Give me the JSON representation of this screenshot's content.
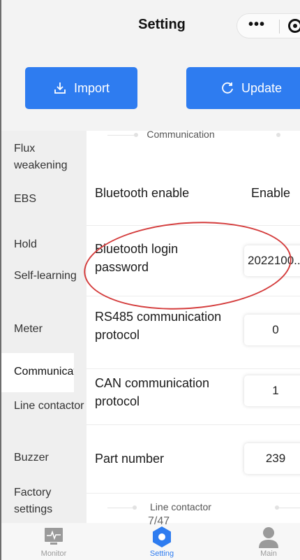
{
  "title_bar": {
    "title": "Setting",
    "more_icon": "more-dots-icon",
    "capsule_icon": "target-icon"
  },
  "actions": {
    "import_label": "Import",
    "update_label": "Update",
    "import_icon": "download-tray-icon",
    "update_icon": "refresh-icon"
  },
  "sidebar": {
    "items": [
      {
        "label": "Flux weakening"
      },
      {
        "label": "EBS"
      },
      {
        "label": "Hold"
      },
      {
        "label": "Self-learning"
      },
      {
        "label": "Meter"
      },
      {
        "label": "Communicat",
        "active": true
      },
      {
        "label": "Line contactor"
      },
      {
        "label": "Buzzer"
      },
      {
        "label": "Factory settings"
      }
    ]
  },
  "content": {
    "top_section": "Communication",
    "rows": [
      {
        "label": "Bluetooth enable",
        "value": "Enable"
      },
      {
        "label": "Bluetooth login password",
        "value": "2022100..."
      },
      {
        "label": "RS485 communication protocol",
        "value": "0"
      },
      {
        "label": "CAN communication protocol",
        "value": "1"
      },
      {
        "label": "Part number",
        "value": "239"
      }
    ],
    "bottom_section": "Line contactor"
  },
  "pager": "7/47",
  "tabbar": {
    "items": [
      {
        "label": "Monitor",
        "icon": "monitor-icon"
      },
      {
        "label": "Setting",
        "icon": "gear-icon",
        "active": true
      },
      {
        "label": "Main",
        "icon": "person-icon"
      }
    ]
  },
  "colors": {
    "accent": "#2e7cf0",
    "annotation": "#d43c3c",
    "sidebar_bg": "#efefef"
  }
}
